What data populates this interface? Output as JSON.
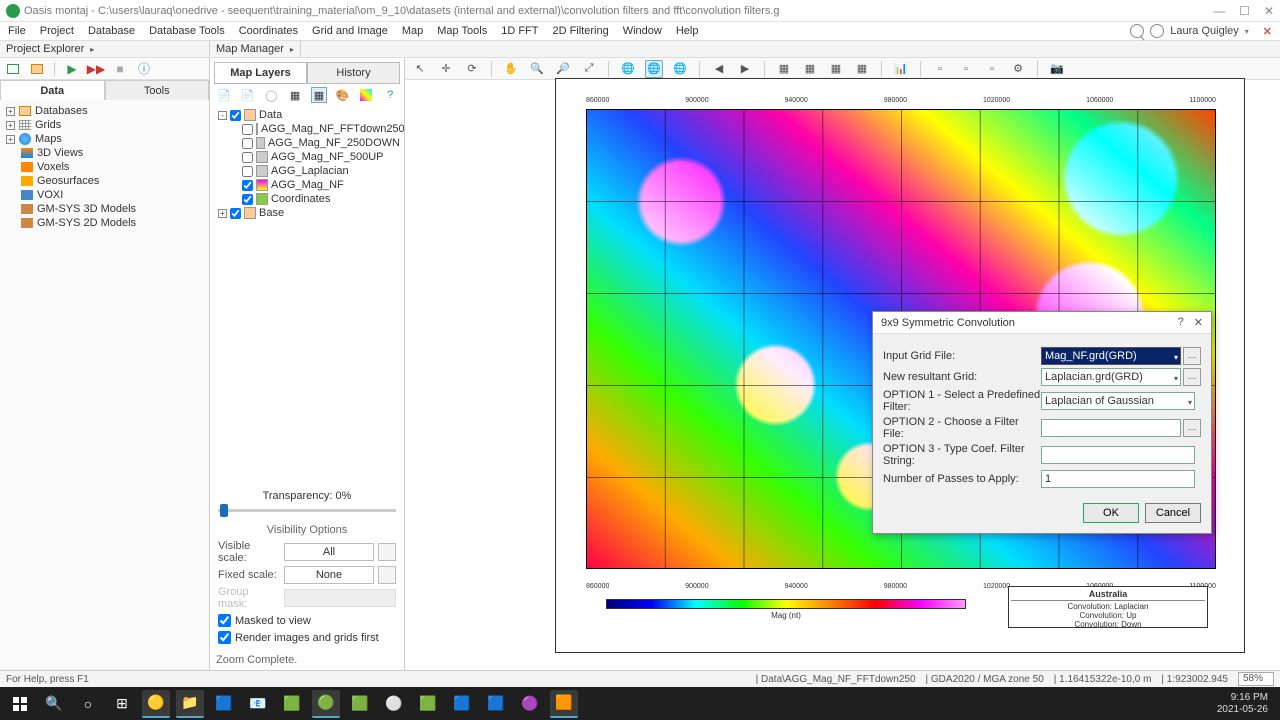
{
  "titlebar": {
    "title": "Oasis montaj - C:\\users\\lauraq\\onedrive - seequent\\training_material\\om_9_10\\datasets (internal and external)\\convolution filters and fft\\convolution filters.g"
  },
  "menubar": {
    "items": [
      "File",
      "Project",
      "Database",
      "Database Tools",
      "Coordinates",
      "Grid and Image",
      "Map",
      "Map Tools",
      "1D FFT",
      "2D Filtering",
      "Window",
      "Help"
    ],
    "user": "Laura Quigley"
  },
  "subheader": {
    "left": "Project Explorer",
    "right": "Map Manager"
  },
  "leftpanel": {
    "tabs": [
      "Data",
      "Tools"
    ],
    "tree": [
      {
        "label": "Databases"
      },
      {
        "label": "Grids"
      },
      {
        "label": "Maps"
      },
      {
        "label": "3D Views"
      },
      {
        "label": "Voxels"
      },
      {
        "label": "Geosurfaces"
      },
      {
        "label": "VOXI"
      },
      {
        "label": "GM-SYS 3D Models"
      },
      {
        "label": "GM-SYS 2D Models"
      }
    ]
  },
  "midpanel": {
    "tabs": [
      "Map Layers",
      "History"
    ],
    "tree": {
      "root": "Data",
      "layers": [
        {
          "label": "AGG_Mag_NF_FFTdown250",
          "checked": false
        },
        {
          "label": "AGG_Mag_NF_250DOWN",
          "checked": false
        },
        {
          "label": "AGG_Mag_NF_500UP",
          "checked": false
        },
        {
          "label": "AGG_Laplacian",
          "checked": false
        },
        {
          "label": "AGG_Mag_NF",
          "checked": true
        },
        {
          "label": "Coordinates",
          "checked": true
        }
      ],
      "base": "Base"
    },
    "transparency_label": "Transparency: 0%",
    "visibility_label": "Visibility Options",
    "visible_scale": {
      "label": "Visible scale:",
      "value": "All"
    },
    "fixed_scale": {
      "label": "Fixed scale:",
      "value": "None"
    },
    "group_mask": {
      "label": "Group mask:"
    },
    "chk_masked": "Masked to view",
    "chk_render": "Render images and grids first",
    "zoom_complete": "Zoom Complete."
  },
  "map": {
    "x_ticks": [
      "860000",
      "900000",
      "940000",
      "980000",
      "1020000",
      "1060000",
      "1100000"
    ],
    "colorbar_label": "Mag (nt)",
    "legend": {
      "title": "Australia",
      "lines": [
        "Convolution: Laplacian",
        "Convolution: Up",
        "Convolution: Down"
      ]
    }
  },
  "dialog": {
    "title": "9x9 Symmetric Convolution",
    "fields": {
      "input_grid": {
        "label": "Input Grid File:",
        "value": "Mag_NF.grd(GRD)"
      },
      "result_grid": {
        "label": "New resultant Grid:",
        "value": "Laplacian.grd(GRD)"
      },
      "opt1": {
        "label": "OPTION 1 - Select a Predefined Filter:",
        "value": "Laplacian of Gaussian"
      },
      "opt2": {
        "label": "OPTION 2 - Choose a Filter File:",
        "value": ""
      },
      "opt3": {
        "label": "OPTION 3 - Type Coef. Filter String:",
        "value": ""
      },
      "passes": {
        "label": "Number of Passes to Apply:",
        "value": "1"
      }
    },
    "ok": "OK",
    "cancel": "Cancel"
  },
  "statusbar": {
    "left": "For Help, press F1",
    "right": [
      "| Data\\AGG_Mag_NF_FFTdown250",
      "| GDA2020 / MGA zone 50",
      "| 1.16415322e-10,0 m",
      "| 1:923002.945"
    ],
    "zoom": "58%"
  },
  "taskbar": {
    "time": "9:16 PM",
    "date": "2021-05-26"
  }
}
